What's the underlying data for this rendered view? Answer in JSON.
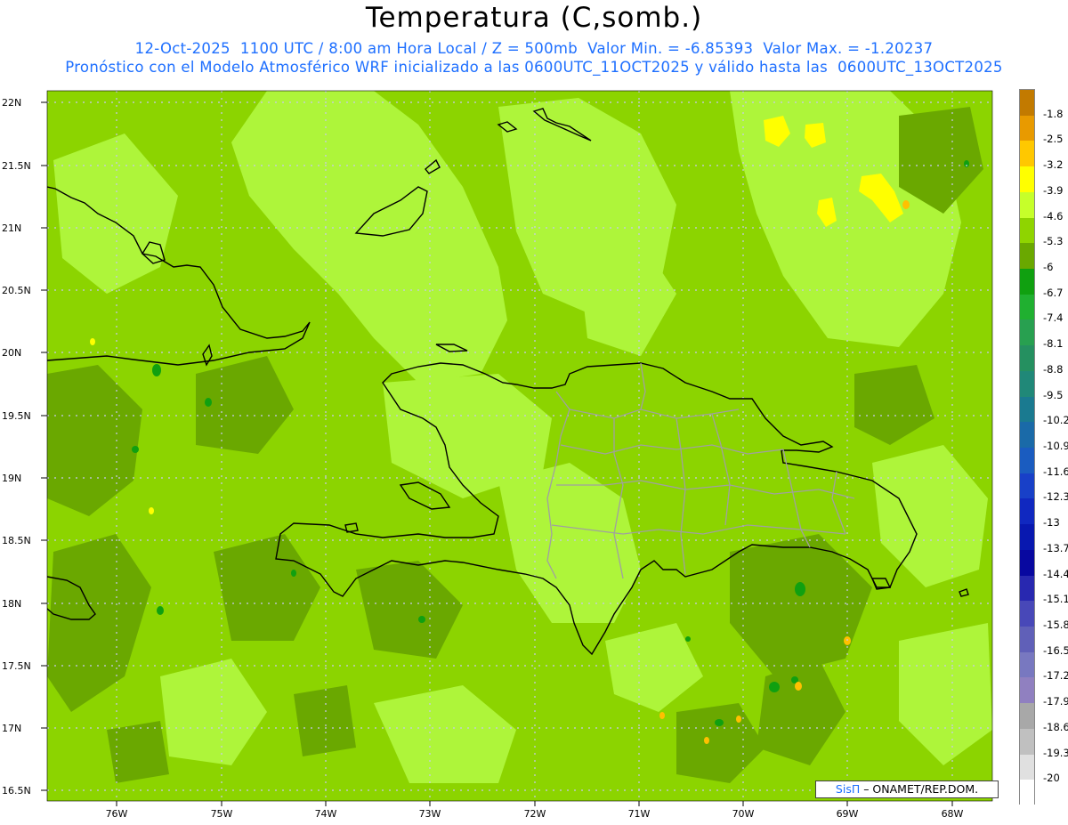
{
  "title": "Temperatura (C,somb.)",
  "subtitle_line1": "12-Oct-2025  1100 UTC / 8:00 am Hora Local / Z = 500mb  Valor Min. = -6.85393  Valor Max. = -1.20237",
  "subtitle_line2": "Pronóstico con el Modelo Atmosférico WRF inicializado a las 0600UTC_11OCT2025 y válido hasta las  0600UTC_13OCT2025",
  "credit": {
    "brand": "SisΠ",
    "text": " – ONAMET/REP.DOM."
  },
  "lat_labels": [
    "22N",
    "21.5N",
    "21N",
    "20.5N",
    "20N",
    "19.5N",
    "19N",
    "18.5N",
    "18N",
    "17.5N",
    "17N",
    "16.5N"
  ],
  "lon_labels": [
    "76W",
    "75W",
    "74W",
    "73W",
    "72W",
    "71W",
    "70W",
    "69W",
    "68W"
  ],
  "colorbar": {
    "labels": [
      "-1.8",
      "-2.5",
      "-3.2",
      "-3.9",
      "-4.6",
      "-5.3",
      "-6",
      "-6.7",
      "-7.4",
      "-8.1",
      "-8.8",
      "-9.5",
      "-10.2",
      "-10.9",
      "-11.6",
      "-12.3",
      "-13",
      "-13.7",
      "-14.4",
      "-15.1",
      "-15.8",
      "-16.5",
      "-17.2",
      "-17.9",
      "-18.6",
      "-19.3",
      "-20"
    ],
    "colors": [
      "#c27a00",
      "#e89a00",
      "#ffc800",
      "#ffff00",
      "#c6ff2a",
      "#8fd400",
      "#6aa800",
      "#10a010",
      "#20b030",
      "#28a050",
      "#259060",
      "#208878",
      "#1a7a90",
      "#1a6aa8",
      "#1a5cc0",
      "#1840c8",
      "#1028c0",
      "#0818b0",
      "#0808a0",
      "#2828b0",
      "#4848b8",
      "#6060b8",
      "#7878c0",
      "#9080c0",
      "#a8a8a8",
      "#c0c0c0",
      "#e0e0e0",
      "#ffffff"
    ]
  },
  "field_colors": {
    "base": "#8cd400",
    "light": "#aef53a",
    "dark": "#66a800",
    "warm": "#ffff00",
    "orange": "#ffc000"
  }
}
